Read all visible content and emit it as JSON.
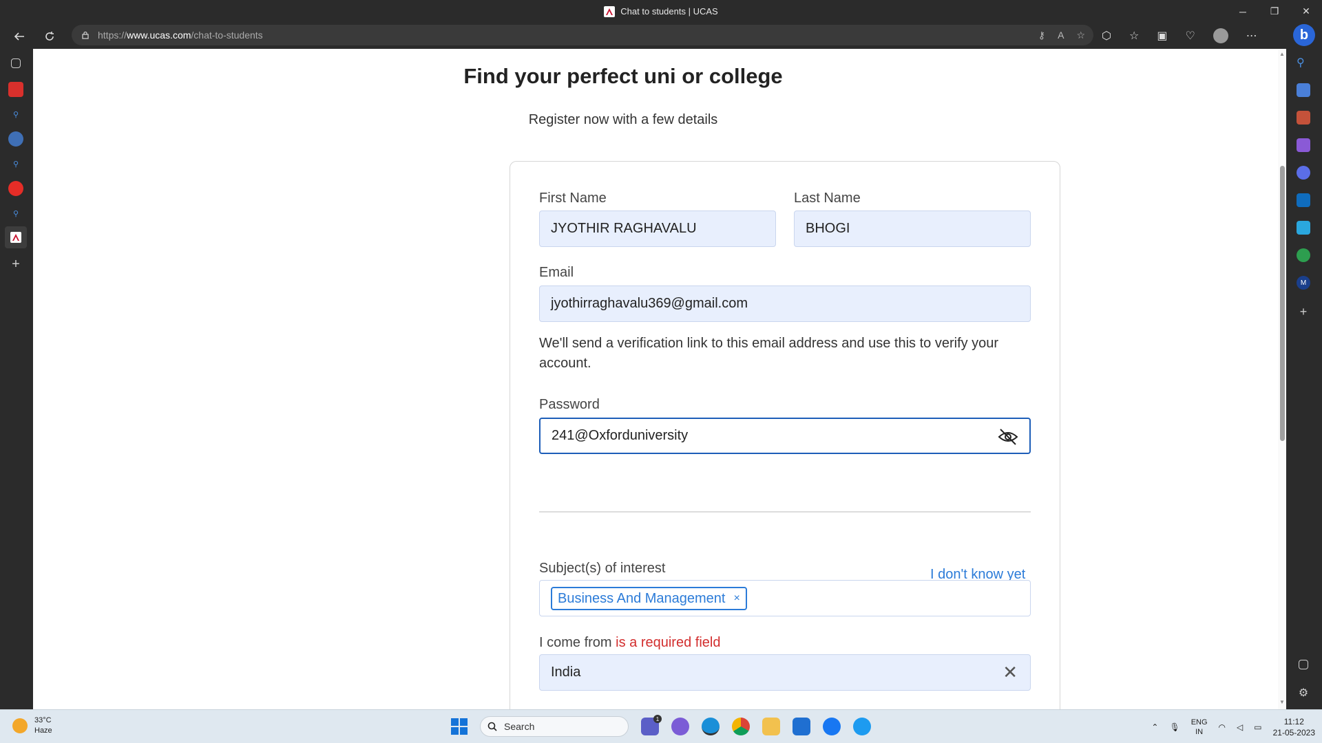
{
  "window": {
    "title": "Chat to students | UCAS",
    "controls": {
      "minimize": "─",
      "restore": "❐",
      "close": "✕"
    }
  },
  "browser": {
    "url_scheme": "https://",
    "url_host": "www.ucas.com",
    "url_path": "/chat-to-students"
  },
  "page": {
    "title": "Find your perfect uni or college",
    "subtitle": "Register now with a few details"
  },
  "form": {
    "first_name_label": "First Name",
    "first_name_value": "JYOTHIR RAGHAVALU",
    "last_name_label": "Last Name",
    "last_name_value": "BHOGI",
    "email_label": "Email",
    "email_value": "jyothirraghavalu369@gmail.com",
    "email_help": "We'll send a verification link to this email address and use this to verify your account.",
    "password_label": "Password",
    "password_value": "241@Oxforduniversity",
    "subjects_label": "Subject(s) of interest",
    "dont_know_link": "I don't know yet",
    "subject_tag": "Business And Management",
    "subject_tag_remove": "×",
    "come_from_label": "I come from",
    "come_from_error": "is a required field",
    "come_from_value": "India"
  },
  "taskbar": {
    "weather_temp": "33°C",
    "weather_desc": "Haze",
    "search_placeholder": "Search",
    "chat_badge": "1",
    "lang_top": "ENG",
    "lang_bottom": "IN",
    "time": "11:12",
    "date": "21-05-2023"
  }
}
